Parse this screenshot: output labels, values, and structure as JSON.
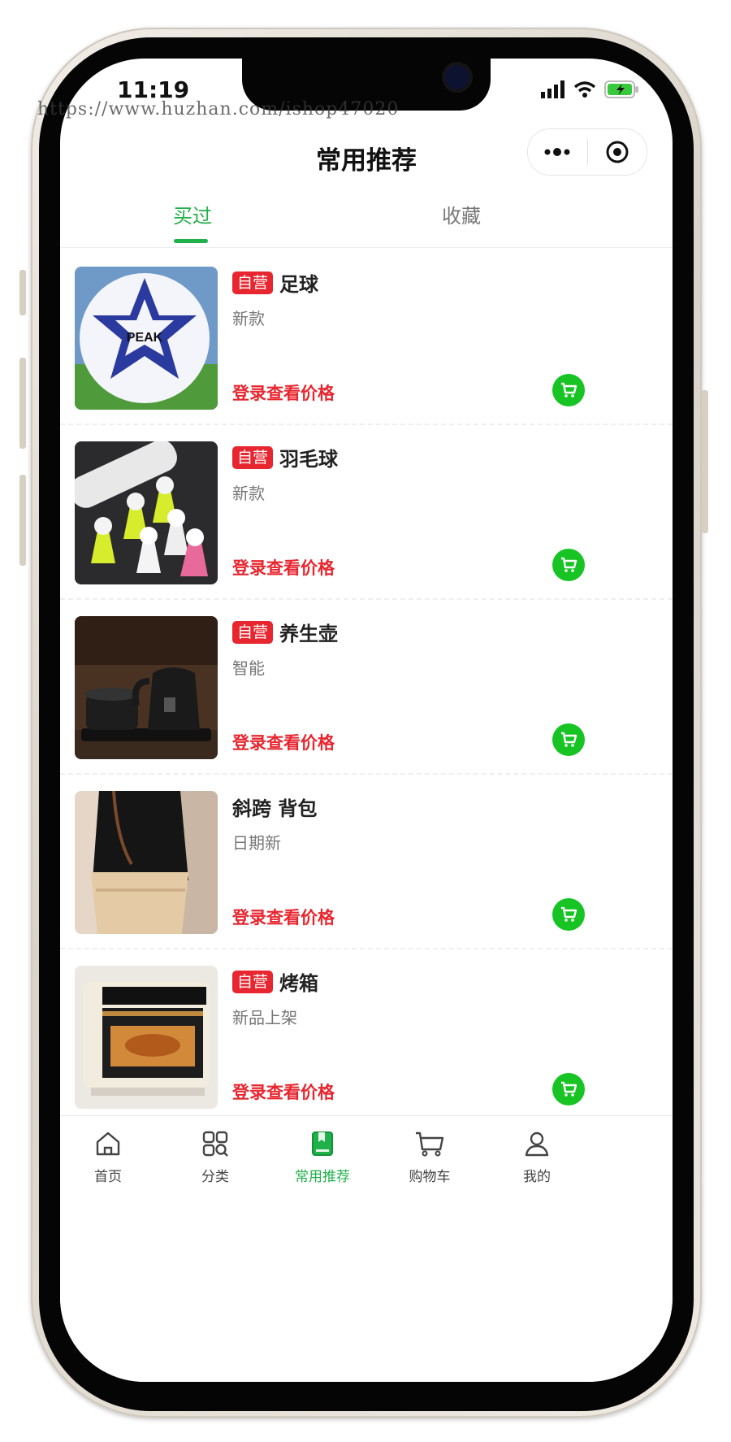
{
  "status_bar": {
    "time": "11:19"
  },
  "watermark": "https://www.huzhan.com/ishop47020",
  "nav": {
    "title": "常用推荐"
  },
  "tabs": [
    {
      "label": "买过",
      "active": true
    },
    {
      "label": "收藏",
      "active": false
    }
  ],
  "products": [
    {
      "badge": "自营",
      "name": "足球",
      "subtitle": "新款",
      "price_text": "登录查看价格",
      "image": "soccer-ball"
    },
    {
      "badge": "自营",
      "name": "羽毛球",
      "subtitle": "新款",
      "price_text": "登录查看价格",
      "image": "shuttlecocks"
    },
    {
      "badge": "自营",
      "name": "养生壶",
      "subtitle": "智能",
      "price_text": "登录查看价格",
      "image": "health-kettle"
    },
    {
      "badge": "",
      "name": "斜跨 背包",
      "subtitle": "日期新",
      "price_text": "登录查看价格",
      "image": "shoulder-bag"
    },
    {
      "badge": "自营",
      "name": "烤箱",
      "subtitle": "新品上架",
      "price_text": "登录查看价格",
      "image": "oven"
    }
  ],
  "tabbar": [
    {
      "label": "首页",
      "icon": "home-icon",
      "active": false
    },
    {
      "label": "分类",
      "icon": "category-icon",
      "active": false
    },
    {
      "label": "常用推荐",
      "icon": "bookmark-icon",
      "active": true
    },
    {
      "label": "购物车",
      "icon": "cart-icon",
      "active": false
    },
    {
      "label": "我的",
      "icon": "user-icon",
      "active": false
    }
  ],
  "colors": {
    "accent": "#20b14a",
    "price": "#e8262f",
    "cart": "#17c424",
    "badge": "#e8262f"
  }
}
